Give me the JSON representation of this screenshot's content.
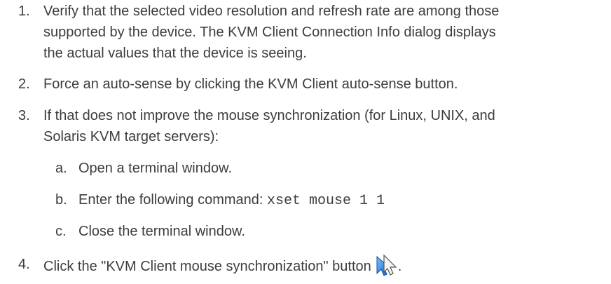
{
  "steps": [
    {
      "number": "1.",
      "lines": [
        "Verify that the selected video resolution and refresh rate are among those",
        "supported by the device. The KVM Client Connection Info dialog displays",
        "the actual values that the device is seeing."
      ]
    },
    {
      "number": "2.",
      "lines": [
        "Force an auto-sense by clicking the KVM Client auto-sense button."
      ]
    },
    {
      "number": "3.",
      "lines": [
        "If that does not improve the mouse synchronization (for Linux, UNIX, and",
        "Solaris KVM target servers):"
      ],
      "substeps": [
        {
          "letter": "a.",
          "text": "Open a terminal window."
        },
        {
          "letter": "b.",
          "text": "Enter the following command: ",
          "code": "xset mouse 1 1"
        },
        {
          "letter": "c.",
          "text": "Close the terminal window."
        }
      ]
    },
    {
      "number": "4.",
      "text": "Click the \"KVM Client mouse synchronization\" button",
      "trailing": ".",
      "icon": "mouse-sync-cursor-icon"
    }
  ]
}
